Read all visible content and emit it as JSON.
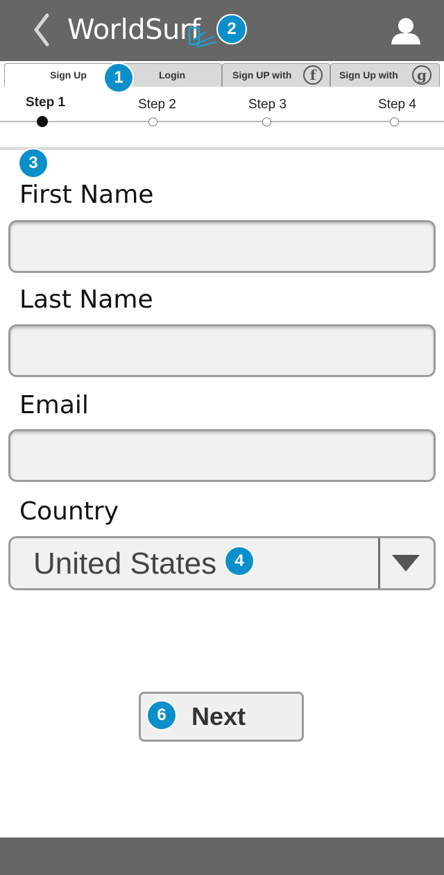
{
  "header": {
    "title": "WorldSurf",
    "back_icon": "chevron-left-icon",
    "logo_icon": "phone-signal-logo-icon",
    "user_icon": "user-icon",
    "background": "#666666"
  },
  "badges": {
    "tabs": "1",
    "logo": "2",
    "form": "3",
    "country": "4",
    "next": "6",
    "color": "#0b8fcb"
  },
  "tabs": [
    {
      "label": "Sign Up",
      "active": true
    },
    {
      "label": "Login",
      "active": false
    },
    {
      "label": "Sign UP with",
      "icon_glyph": "f",
      "icon": "facebook-icon",
      "active": false
    },
    {
      "label": "Sign Up with",
      "icon_glyph": "g",
      "icon": "google-icon",
      "active": false
    }
  ],
  "steps": [
    {
      "label": "Step 1",
      "current": true
    },
    {
      "label": "Step 2",
      "current": false
    },
    {
      "label": "Step 3",
      "current": false
    },
    {
      "label": "Step 4",
      "current": false
    }
  ],
  "form": {
    "first_name": {
      "label": "First Name",
      "value": ""
    },
    "last_name": {
      "label": "Last Name",
      "value": ""
    },
    "email": {
      "label": "Email",
      "value": ""
    },
    "country": {
      "label": "Country",
      "value": "United States"
    }
  },
  "next_button": {
    "label": "Next"
  }
}
